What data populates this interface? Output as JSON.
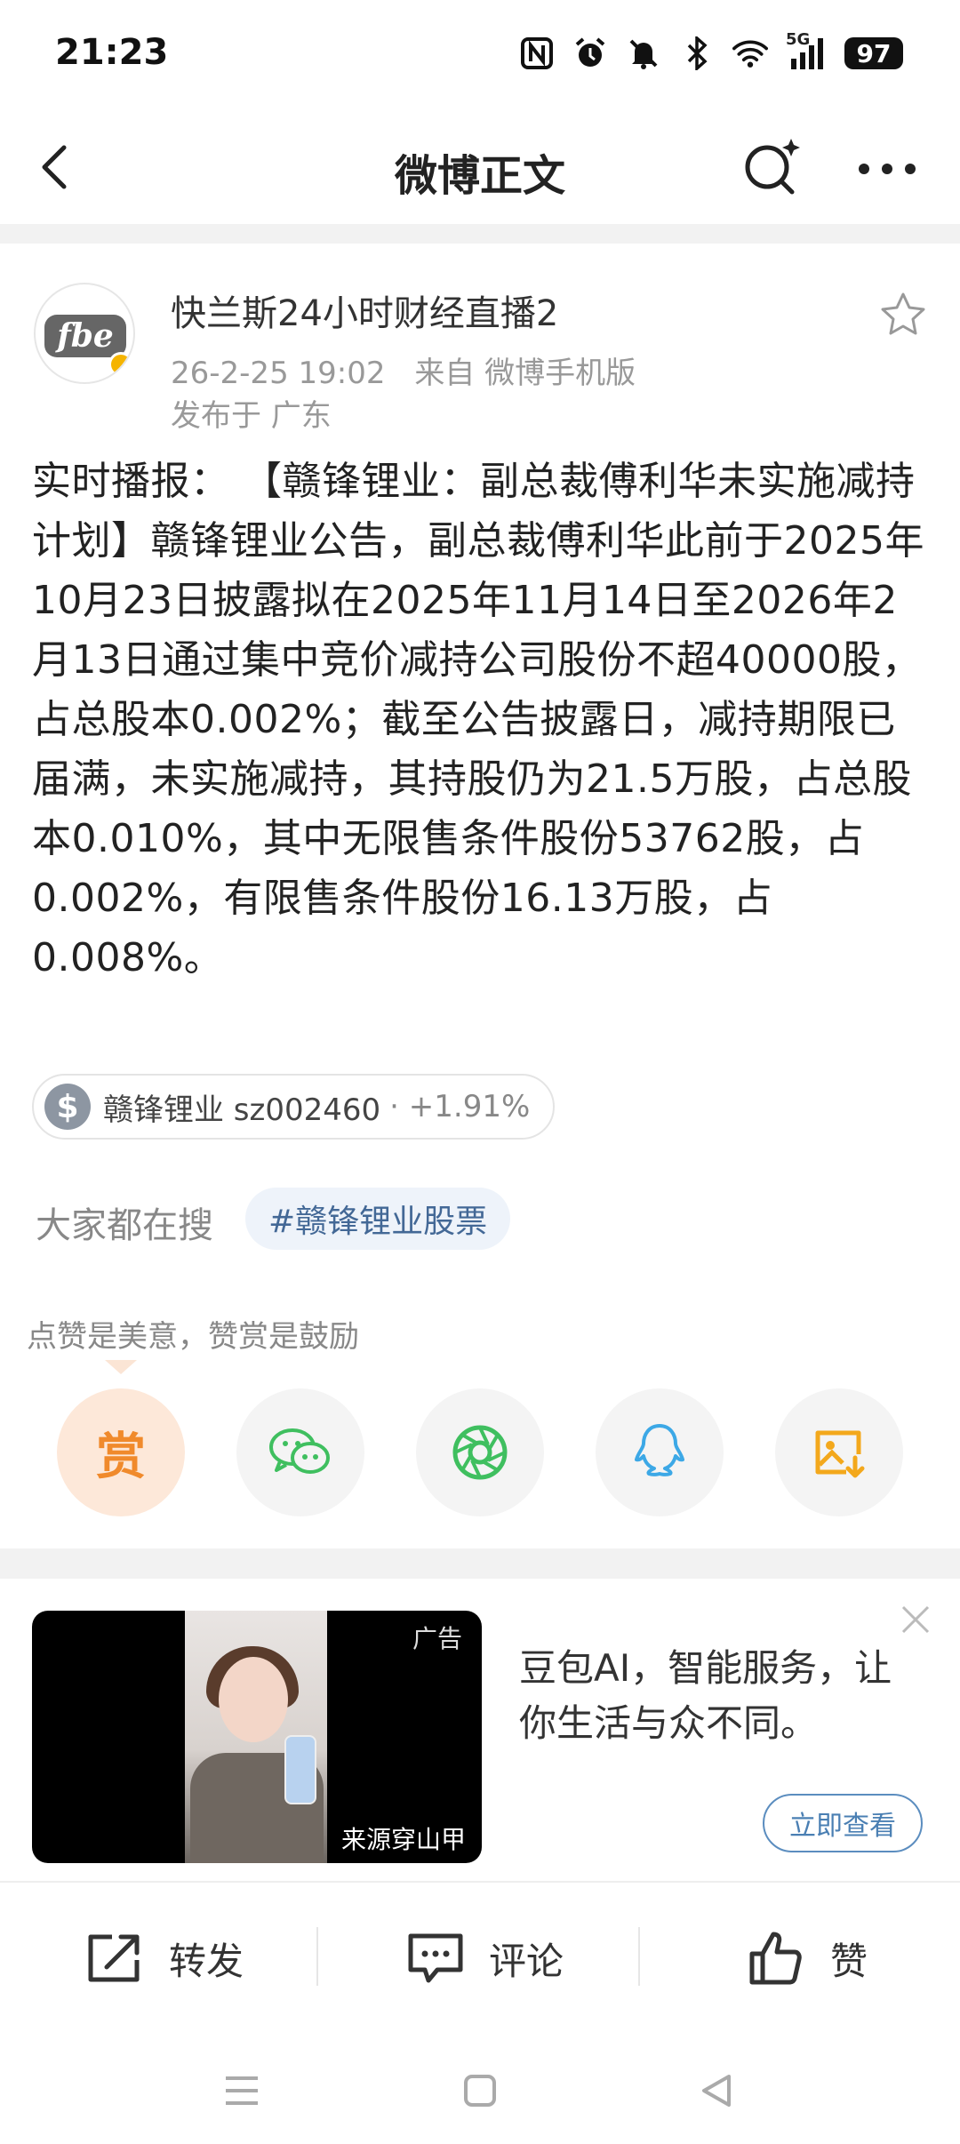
{
  "status_bar": {
    "time": "21:23",
    "network_label": "5G",
    "battery": "97",
    "icons": [
      "nfc-icon",
      "alarm-icon",
      "mute-icon",
      "bluetooth-icon",
      "wifi-icon",
      "signal-icon",
      "battery-icon"
    ]
  },
  "nav": {
    "title": "微博正文",
    "icons": [
      "back-arrow-icon",
      "search-sparkle-icon",
      "more-dots-icon"
    ]
  },
  "post": {
    "author": "快兰斯24小时财经直播2",
    "avatar_text": "fbe",
    "time": "26-2-25 19:02",
    "source": "来自 微博手机版",
    "location": "发布于 广东",
    "body": "实时播报：  【赣锋锂业：副总裁傅利华未实施减持计划】赣锋锂业公告，副总裁傅利华此前于2025年10月23日披露拟在2025年11月14日至2026年2月13日通过集中竞价减持公司股份不超40000股，占总股本0.002%；截至公告披露日，减持期限已届满，未实施减持，其持股仍为21.5万股，占总股本0.010%，其中无限售条件股份53762股，占0.002%，有限售条件股份16.13万股，占0.008%。",
    "stock_chip": {
      "icon_text": "$",
      "name": "赣锋锂业 sz002460",
      "change": "· +1.91%"
    }
  },
  "hot_search": {
    "label": "大家都在搜",
    "tag": "#赣锋锂业股票"
  },
  "reward_tip": "点赞是美意，赞赏是鼓励",
  "share_row": [
    {
      "name": "reward",
      "text": "赏"
    },
    {
      "name": "wechat"
    },
    {
      "name": "moments"
    },
    {
      "name": "qq"
    },
    {
      "name": "save-image"
    }
  ],
  "ad": {
    "mark": "广告",
    "source": "来源穿山甲",
    "text": "豆包AI，智能服务，让你生活与众不同。",
    "cta": "立即查看"
  },
  "actions": {
    "repost": "转发",
    "comment": "评论",
    "like": "赞"
  },
  "colors": {
    "accent_orange": "#f08a2c",
    "link_blue": "#436896",
    "wechat_green": "#3fbf5f",
    "qq_blue": "#3ca8e6",
    "save_yellow": "#f3a81c"
  }
}
